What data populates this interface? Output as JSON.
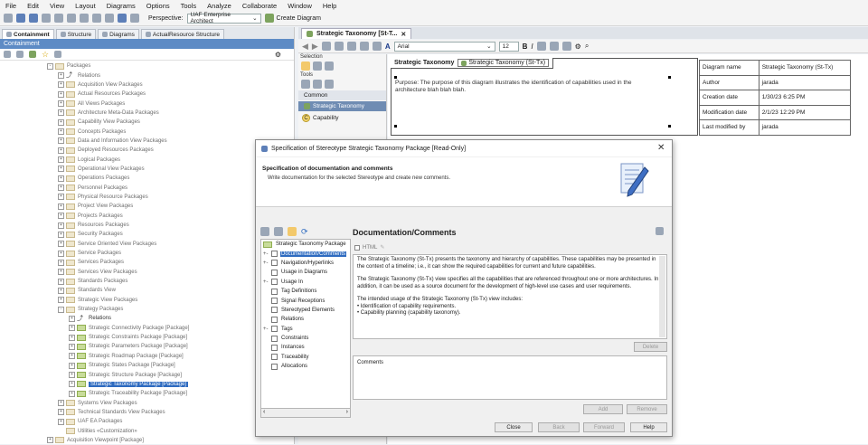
{
  "menubar": [
    "File",
    "Edit",
    "View",
    "Layout",
    "Diagrams",
    "Options",
    "Tools",
    "Analyze",
    "Collaborate",
    "Window",
    "Help"
  ],
  "toolbar": {
    "perspective_label": "Perspective:",
    "perspective_value": "UAF Enterprise Architect",
    "create_diagram_label": "Create Diagram"
  },
  "left_panel": {
    "tabs": [
      "Containment",
      "Structure",
      "Diagrams",
      "ActualResource Structure"
    ],
    "header": "Containment",
    "tree": [
      {
        "indent": 0,
        "label": "Packages",
        "kind": "folder",
        "toggle": "-"
      },
      {
        "indent": 1,
        "label": "Relations",
        "kind": "rel",
        "toggle": "+"
      },
      {
        "indent": 1,
        "label": "Acquisition View Packages",
        "kind": "folder",
        "toggle": "+"
      },
      {
        "indent": 1,
        "label": "Actual Resources Packages",
        "kind": "folder",
        "toggle": "+"
      },
      {
        "indent": 1,
        "label": "All Views Packages",
        "kind": "folder",
        "toggle": "+"
      },
      {
        "indent": 1,
        "label": "Architecture Meta-Data Packages",
        "kind": "folder",
        "toggle": "+"
      },
      {
        "indent": 1,
        "label": "Capability View Packages",
        "kind": "folder",
        "toggle": "+"
      },
      {
        "indent": 1,
        "label": "Concepts Packages",
        "kind": "folder",
        "toggle": "+"
      },
      {
        "indent": 1,
        "label": "Data and Information View Packages",
        "kind": "folder",
        "toggle": "+"
      },
      {
        "indent": 1,
        "label": "Deployed Resources Packages",
        "kind": "folder",
        "toggle": "+"
      },
      {
        "indent": 1,
        "label": "Logical Packages",
        "kind": "folder",
        "toggle": "+"
      },
      {
        "indent": 1,
        "label": "Operational View Packages",
        "kind": "folder",
        "toggle": "+"
      },
      {
        "indent": 1,
        "label": "Operations Packages",
        "kind": "folder",
        "toggle": "+"
      },
      {
        "indent": 1,
        "label": "Personnel Packages",
        "kind": "folder",
        "toggle": "+"
      },
      {
        "indent": 1,
        "label": "Physical Resource Packages",
        "kind": "folder",
        "toggle": "+"
      },
      {
        "indent": 1,
        "label": "Project View Packages",
        "kind": "folder",
        "toggle": "+"
      },
      {
        "indent": 1,
        "label": "Projects Packages",
        "kind": "folder",
        "toggle": "+"
      },
      {
        "indent": 1,
        "label": "Resources Packages",
        "kind": "folder",
        "toggle": "+"
      },
      {
        "indent": 1,
        "label": "Security Packages",
        "kind": "folder",
        "toggle": "+"
      },
      {
        "indent": 1,
        "label": "Service Oriented View Packages",
        "kind": "folder",
        "toggle": "+"
      },
      {
        "indent": 1,
        "label": "Service Packages",
        "kind": "folder",
        "toggle": "+"
      },
      {
        "indent": 1,
        "label": "Services Packages",
        "kind": "folder",
        "toggle": "+"
      },
      {
        "indent": 1,
        "label": "Services View Packages",
        "kind": "folder",
        "toggle": "+"
      },
      {
        "indent": 1,
        "label": "Standards Packages",
        "kind": "folder",
        "toggle": "+"
      },
      {
        "indent": 1,
        "label": "Standards View",
        "kind": "folder",
        "toggle": "+"
      },
      {
        "indent": 1,
        "label": "Strategic View Packages",
        "kind": "folder",
        "toggle": "+"
      },
      {
        "indent": 1,
        "label": "Strategy Packages",
        "kind": "folder",
        "toggle": "-"
      },
      {
        "indent": 2,
        "label": "Relations",
        "kind": "rel",
        "toggle": "+",
        "dark": true
      },
      {
        "indent": 2,
        "label": "Strategic Connectivity Package [Package]",
        "kind": "gfolder",
        "toggle": "+"
      },
      {
        "indent": 2,
        "label": "Strategic Constraints Package [Package]",
        "kind": "gfolder",
        "toggle": "+"
      },
      {
        "indent": 2,
        "label": "Strategic Parameters Package [Package]",
        "kind": "gfolder",
        "toggle": "+"
      },
      {
        "indent": 2,
        "label": "Strategic Roadmap Package [Package]",
        "kind": "gfolder",
        "toggle": "+"
      },
      {
        "indent": 2,
        "label": "Strategic States Package [Package]",
        "kind": "gfolder",
        "toggle": "+"
      },
      {
        "indent": 2,
        "label": "Strategic Structure Package [Package]",
        "kind": "gfolder",
        "toggle": "+"
      },
      {
        "indent": 2,
        "label": "Strategic Taxonomy Package [Package]",
        "kind": "gfolder",
        "toggle": "+",
        "selected": true
      },
      {
        "indent": 2,
        "label": "Strategic Traceability Package [Package]",
        "kind": "gfolder",
        "toggle": "+"
      },
      {
        "indent": 1,
        "label": "Systems View Packages",
        "kind": "folder",
        "toggle": "+"
      },
      {
        "indent": 1,
        "label": "Technical Standards View Packages",
        "kind": "folder",
        "toggle": "+"
      },
      {
        "indent": 1,
        "label": "UAF EA Packages",
        "kind": "folder",
        "toggle": "+"
      },
      {
        "indent": 1,
        "label": "Utilities «Customization»",
        "kind": "folder",
        "toggle": ""
      },
      {
        "indent": 0,
        "label": "Acquisition Viewpoint [Package]",
        "kind": "folder",
        "toggle": "+"
      }
    ]
  },
  "diagram": {
    "tab_label": "Strategic Taxonomy [St-T...",
    "font_name": "Arial",
    "font_size": "12",
    "palette": {
      "selection": "Selection",
      "tools": "Tools",
      "common": "Common",
      "group": "Strategic Taxonomy",
      "item": "Capability"
    },
    "frame_title": "Strategic Taxonomy",
    "frame_subtitle": "Strategic Taxonomy (St-Tx)",
    "purpose_text": "Purpose: The purpose of this diagram illustrates the identification of capabilities used in the architecture blah blah blah.",
    "info_rows": [
      {
        "label": "Diagram name",
        "value": "Strategic Taxonomy (St-Tx)"
      },
      {
        "label": "Author",
        "value": "jarada"
      },
      {
        "label": "Creation date",
        "value": "1/30/23 6:25 PM"
      },
      {
        "label": "Modification date",
        "value": "2/1/23 12:29 PM"
      },
      {
        "label": "Last modified by",
        "value": "jarada"
      }
    ]
  },
  "dialog": {
    "title": "Specification of Stereotype Strategic Taxonomy Package [Read-Only]",
    "header_title": "Specification of documentation and comments",
    "header_subtitle": "Write documentation for the selected Stereotype and create new comments.",
    "tree_root": "Strategic Taxonomy Package",
    "tree_items": [
      {
        "label": "Documentation/Comments",
        "toggle": "+",
        "selected": true
      },
      {
        "label": "Navigation/Hyperlinks",
        "toggle": "+"
      },
      {
        "label": "Usage in Diagrams",
        "toggle": ""
      },
      {
        "label": "Usage In",
        "toggle": "+"
      },
      {
        "label": "Tag Definitions",
        "toggle": ""
      },
      {
        "label": "Signal Receptions",
        "toggle": ""
      },
      {
        "label": "Stereotyped Elements",
        "toggle": ""
      },
      {
        "label": "Relations",
        "toggle": ""
      },
      {
        "label": "Tags",
        "toggle": "+"
      },
      {
        "label": "Constraints",
        "toggle": ""
      },
      {
        "label": "Instances",
        "toggle": ""
      },
      {
        "label": "Traceability",
        "toggle": ""
      },
      {
        "label": "Allocations",
        "toggle": ""
      }
    ],
    "panel_title": "Documentation/Comments",
    "html_label": "HTML",
    "doc_paragraphs": [
      "The Strategic Taxonomy (St-Tx) presents the taxonomy and hierarchy of capabilities. These capabilities may be presented in the context of a timeline; i.e., it can show the required capabilities for current and future capabilities.",
      "The Strategic Taxonomy (St-Tx) view specifies all the capabilities that are referenced throughout one or more architectures. In addition, it can be used as a source document for the development of high-level use cases and user requirements.",
      "The intended usage of the Strategic Taxonomy (St-Tx) view includes:"
    ],
    "doc_bullets": [
      "• Identification of capability requirements.",
      "• Capability planning (capability taxonomy)."
    ],
    "delete_label": "Delete",
    "comments_label": "Comments",
    "add_label": "Add",
    "remove_label": "Remove",
    "buttons": [
      "Close",
      "Back",
      "Forward",
      "Help"
    ]
  }
}
